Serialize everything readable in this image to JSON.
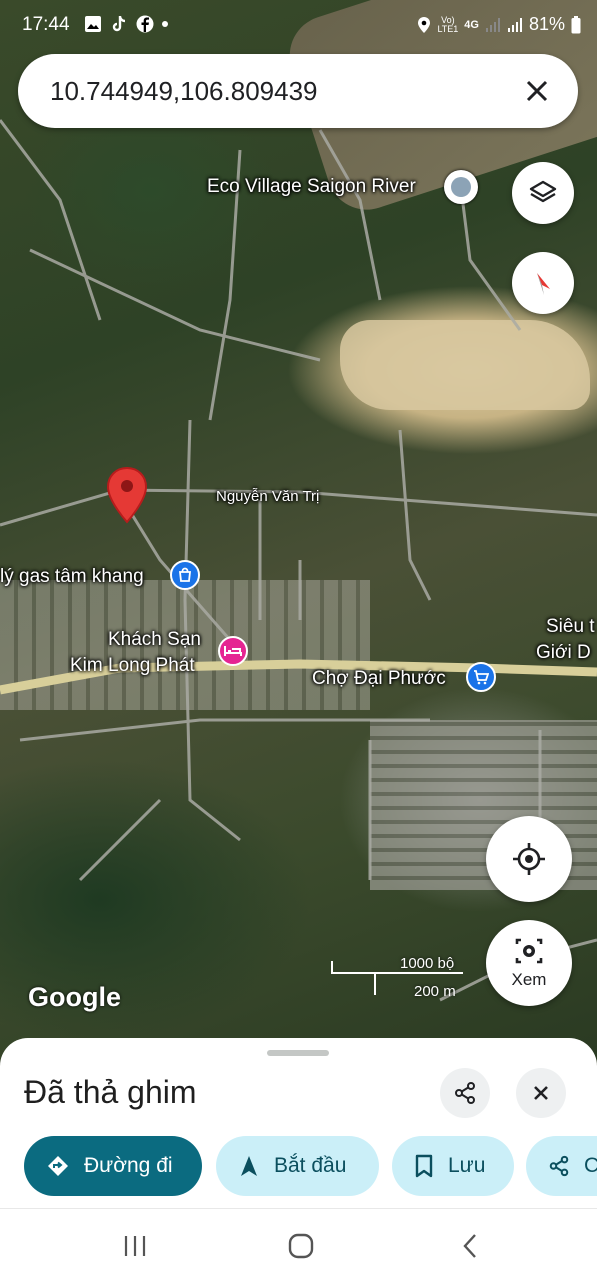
{
  "status_bar": {
    "time": "17:44",
    "notification_icons": [
      "gallery-icon",
      "tiktok-icon",
      "facebook-icon",
      "dot-icon"
    ],
    "network_label_top": "Vo)",
    "network_label_bottom": "LTE1",
    "network_type": "4G",
    "battery": "81%"
  },
  "search": {
    "value": "10.744949,106.809439"
  },
  "map": {
    "labels": {
      "eco_village": "Eco Village Saigon River",
      "nguyen_van_tri": "Nguyễn Văn Trị",
      "gas": "lý gas tâm khang",
      "hotel_line1": "Khách Sạn",
      "hotel_line2": "Kim Long Phát",
      "market": "Chợ Đại Phước",
      "sieu_thi_line1": "Siêu t",
      "sieu_thi_line2": "Giới D"
    },
    "attribution": "Google",
    "scale": {
      "imperial": "1000 bộ",
      "metric": "200 m"
    },
    "lens_label": "Xem",
    "colors": {
      "pin": "#e53935",
      "shop_poi": "#1a73e8",
      "hotel_poi": "#e52592",
      "road_major": "#d8cf9a"
    }
  },
  "sheet": {
    "title": "Đã thả ghim",
    "chips": [
      {
        "label": "Đường đi",
        "icon": "directions-icon"
      },
      {
        "label": "Bắt đầu",
        "icon": "navigation-arrow-icon"
      },
      {
        "label": "Lưu",
        "icon": "bookmark-icon"
      },
      {
        "label": "C",
        "icon": "share-icon"
      }
    ]
  }
}
